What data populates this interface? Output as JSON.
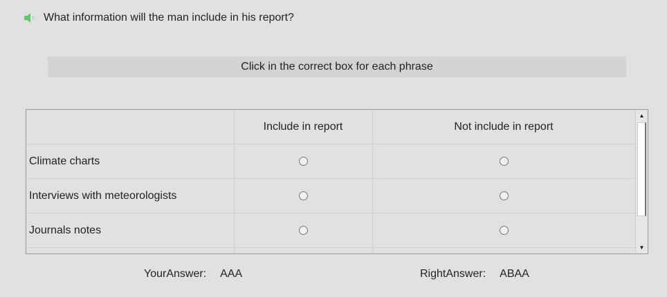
{
  "question": {
    "text": "What information will the man include in his report?",
    "icon": "speaker-icon",
    "icon_color": "#5fc76b"
  },
  "instruction": "Click in the correct box for each phrase",
  "table": {
    "columns": [
      "",
      "Include in report",
      "Not include in report"
    ],
    "rows": [
      {
        "phrase": "Climate charts"
      },
      {
        "phrase": "Interviews with meteorologists"
      },
      {
        "phrase": "Journals notes"
      },
      {
        "phrase": ""
      }
    ]
  },
  "scrollbar": {
    "up_glyph": "▲",
    "down_glyph": "▼"
  },
  "answers": {
    "your_label": "YourAnswer:",
    "your_value": "AAA",
    "right_label": "RightAnswer:",
    "right_value": "ABAA"
  }
}
